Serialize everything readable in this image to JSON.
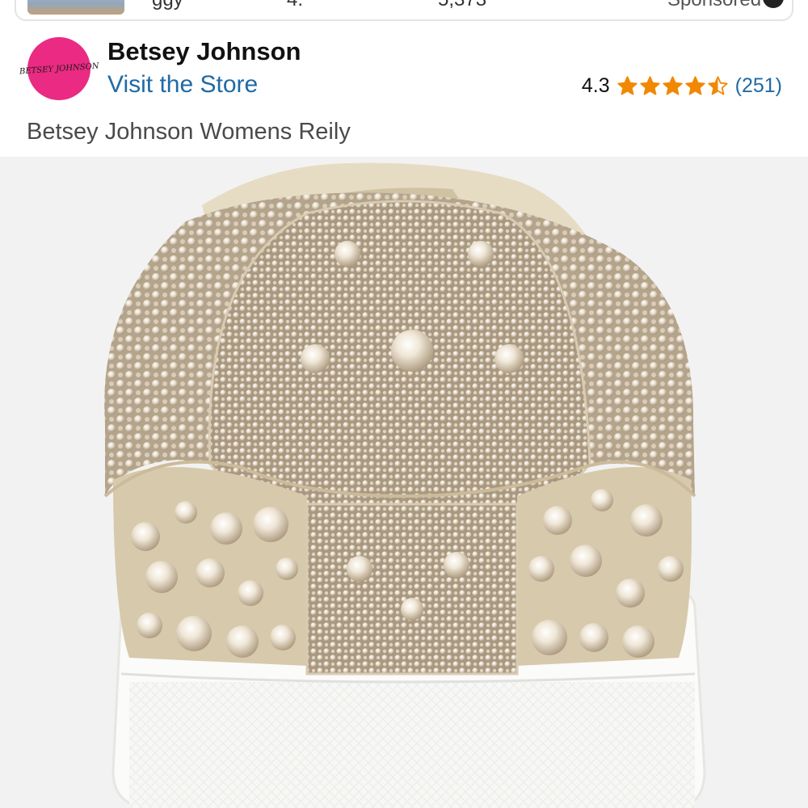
{
  "top_card": {
    "fragments": [
      "ggy",
      "4.",
      "5,373",
      "Sponsored"
    ]
  },
  "brand": {
    "logo_text": "BETSEY JOHNSON",
    "name": "Betsey Johnson",
    "visit_store": "Visit the Store"
  },
  "rating": {
    "value": "4.3",
    "stars": 4.5,
    "count": "(251)"
  },
  "product": {
    "title": "Betsey Johnson Womens Reily"
  },
  "colors": {
    "link": "#1f6aa5",
    "star": "#f08804",
    "logo_bg": "#ea2a83"
  },
  "icons": {
    "star": "star-icon",
    "info": "info-icon"
  }
}
